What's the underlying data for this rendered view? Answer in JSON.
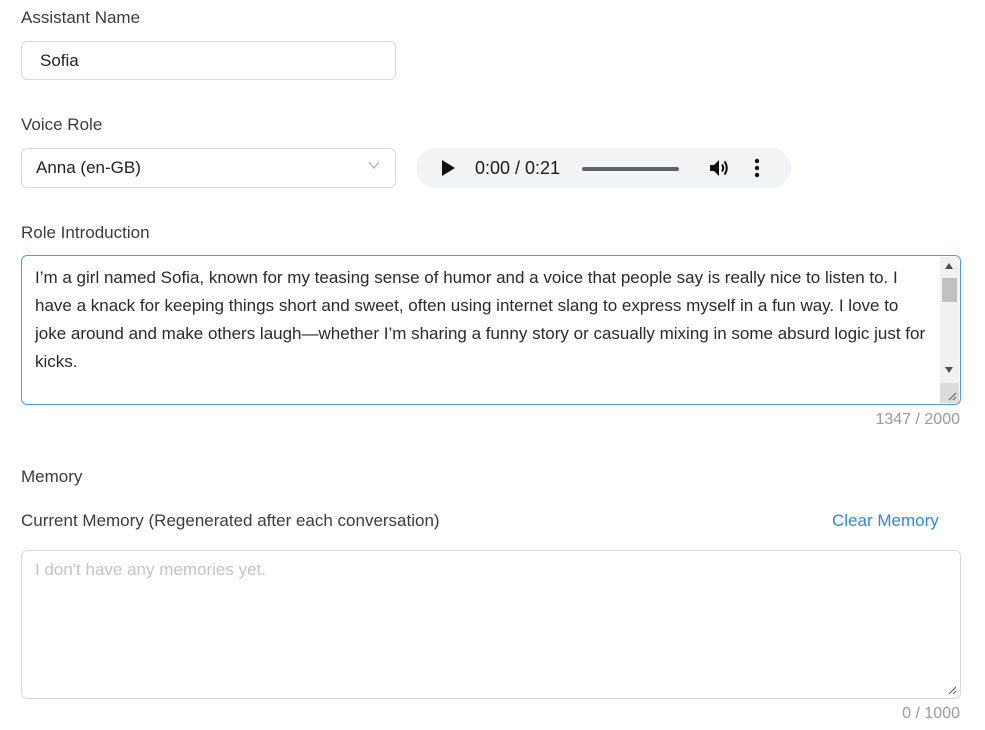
{
  "assistant_name": {
    "label": "Assistant Name",
    "value": "Sofia"
  },
  "voice_role": {
    "label": "Voice Role",
    "selected": "Anna (en-GB)",
    "audio": {
      "time": "0:00 / 0:21",
      "progress": 0
    }
  },
  "role_intro": {
    "label": "Role Introduction",
    "text": "I’m a girl named Sofia, known for my teasing sense of humor and a voice that people say is really nice to listen to. I have a knack for keeping things short and sweet, often using internet slang to express myself in a fun way. I love to joke around and make others laugh—whether I’m sharing a funny story or casually mixing in some absurd logic just for kicks.",
    "counter": "1347 / 2000"
  },
  "memory": {
    "heading": "Memory",
    "current_label": "Current Memory (Regenerated after each conversation)",
    "clear_label": "Clear Memory",
    "placeholder": "I don't have any memories yet.",
    "counter": "0 / 1000"
  },
  "colors": {
    "accent": "#2f86e8",
    "focus_border": "#4a9cf0",
    "border": "#d9d9d9"
  }
}
